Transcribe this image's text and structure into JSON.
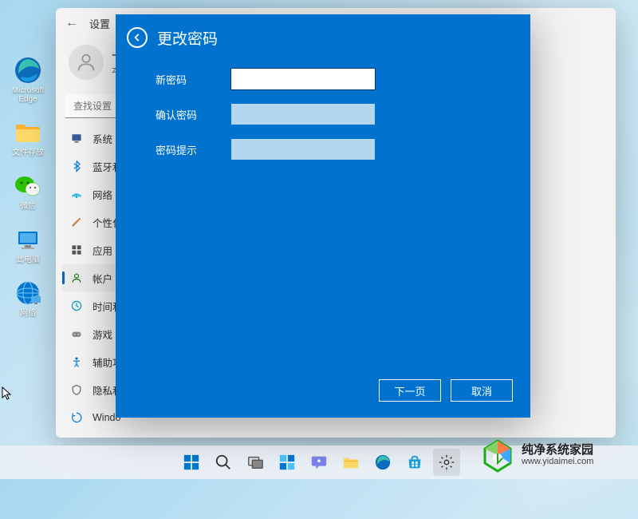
{
  "desktop": {
    "icons": [
      {
        "name": "edge-icon",
        "label": "Microsoft Edge"
      },
      {
        "name": "folder-icon",
        "label": "文件存放"
      },
      {
        "name": "wechat-icon",
        "label": "微信"
      },
      {
        "name": "this-pc-icon",
        "label": "此电脑"
      },
      {
        "name": "network-icon",
        "label": "网络"
      }
    ]
  },
  "settings": {
    "title": "设置",
    "user": {
      "name": "十",
      "sub": "本"
    },
    "search_placeholder": "查找设置",
    "nav": [
      {
        "icon": "system",
        "label": "系统",
        "color": "#3b3b6d"
      },
      {
        "icon": "bluetooth",
        "label": "蓝牙和",
        "color": "#0078d4"
      },
      {
        "icon": "network",
        "label": "网络 &",
        "color": "#00a2ed"
      },
      {
        "icon": "personalize",
        "label": "个性化",
        "color": "#d08040"
      },
      {
        "icon": "apps",
        "label": "应用",
        "color": "#555"
      },
      {
        "icon": "accounts",
        "label": "帐户",
        "color": "#107c10",
        "active": true
      },
      {
        "icon": "time",
        "label": "时间和",
        "color": "#0099bc"
      },
      {
        "icon": "gaming",
        "label": "游戏",
        "color": "#888"
      },
      {
        "icon": "accessibility",
        "label": "辅助功",
        "color": "#0078d4"
      },
      {
        "icon": "privacy",
        "label": "隐私和",
        "color": "#666"
      },
      {
        "icon": "update",
        "label": "Windo",
        "color": "#0078d4"
      }
    ]
  },
  "dialog": {
    "title": "更改密码",
    "fields": {
      "new_password": "新密码",
      "confirm_password": "确认密码",
      "password_hint": "密码提示"
    },
    "buttons": {
      "next": "下一页",
      "cancel": "取消"
    }
  },
  "watermark": {
    "line1": "纯净系统家园",
    "line2": "www.yidaimei.com"
  }
}
